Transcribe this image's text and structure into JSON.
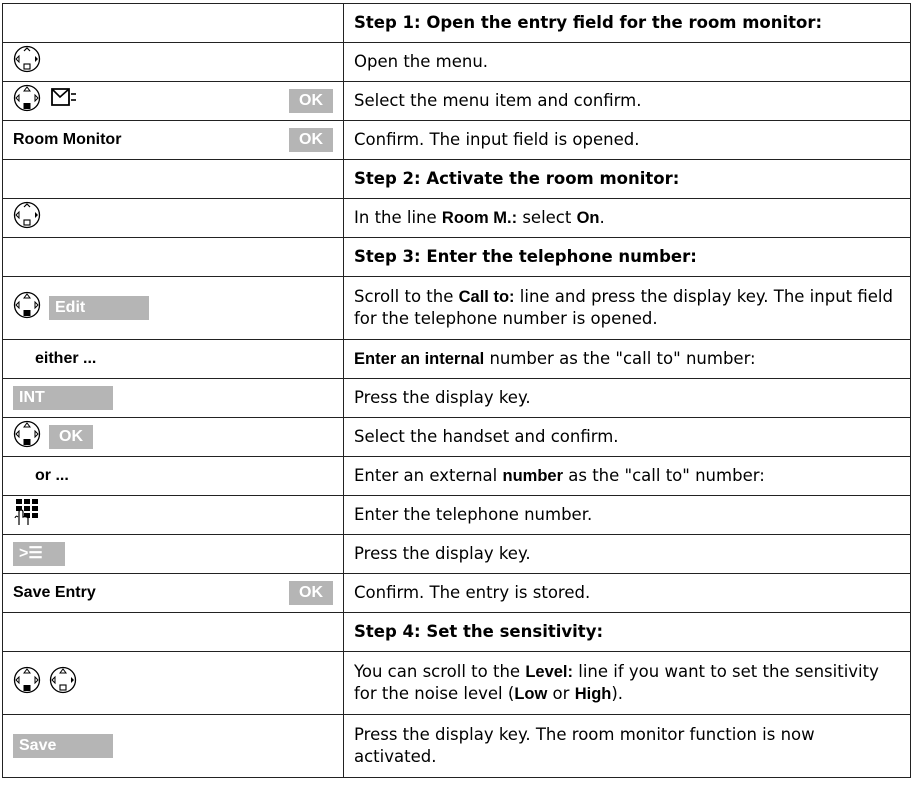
{
  "rows": [
    {
      "left": "",
      "right": "Step 1: Open the entry field for the room monitor:"
    },
    {
      "right": "Open the menu."
    },
    {
      "key": "OK",
      "right": "Select the menu item and confirm."
    },
    {
      "left": "Room Monitor",
      "key": "OK",
      "right": "Confirm. The input field is opened."
    },
    {
      "right": "Step 2: Activate the room monitor:"
    },
    {
      "right_pre": "In the line ",
      "right_b1": "Room M.:",
      "right_mid": " select ",
      "right_b2": "On",
      "right_post": "."
    },
    {
      "right": "Step 3: Enter the telephone number:"
    },
    {
      "key": "Edit",
      "right_pre": "Scroll to the ",
      "right_b1": "Call to:",
      "right_post": " line and press the display key. The input field for the telephone number is opened."
    },
    {
      "left": "either ...",
      "right_b1": "Enter an internal",
      "right_post": " number as the \"call to\" number:"
    },
    {
      "key": "INT",
      "right": "Press the display key."
    },
    {
      "key": "OK",
      "right": "Select the handset and confirm."
    },
    {
      "left": "or ...",
      "right_pre": "Enter an external ",
      "right_b1": "number",
      "right_post": " as the \"call to\" number:"
    },
    {
      "right": "Enter the telephone number."
    },
    {
      "key": "˃☰",
      "right": "Press the display key."
    },
    {
      "left": "Save Entry",
      "key": "OK",
      "right": "Confirm. The entry is stored."
    },
    {
      "right": "Step 4: Set the sensitivity:"
    },
    {
      "right_pre": "You can scroll to the ",
      "right_b1": "Level:",
      "right_mid": " line if you want to set the sensitivity for the noise level (",
      "right_b2": "Low",
      "right_mid2": " or ",
      "right_b3": "High",
      "right_post": ")."
    },
    {
      "key": "Save",
      "right": "Press the display key. The room monitor function is now activated."
    }
  ]
}
